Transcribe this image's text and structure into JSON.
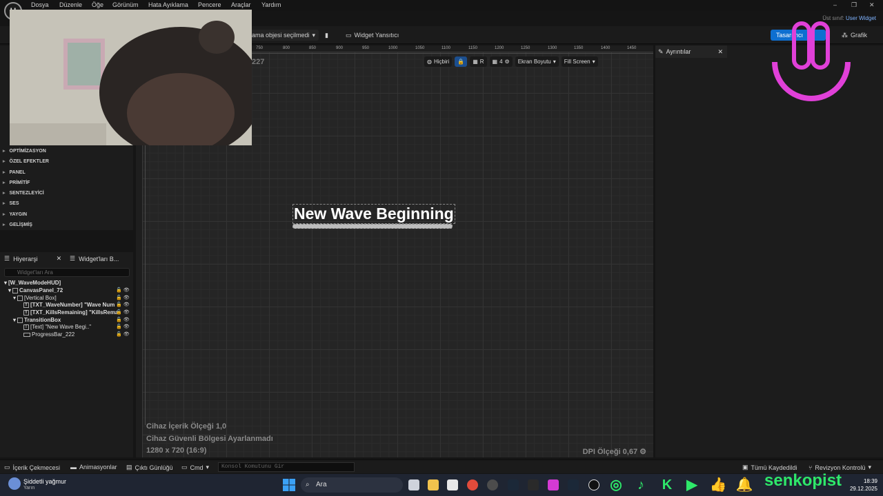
{
  "menu": [
    "Dosya",
    "Düzenle",
    "Öğe",
    "Görünüm",
    "Hata Ayıklama",
    "Pencere",
    "Araçlar",
    "Yardım"
  ],
  "parent_class": {
    "label": "Üst sınıf:",
    "value": "User Widget"
  },
  "toolbar": {
    "debug_filter": "ama objesi seçilmedi",
    "widget_reflector": "Widget Yansıtıcı",
    "designer": "Tasarımcı",
    "graph": "Grafik"
  },
  "palette": {
    "categories": [
      "OPTİMİZASYON",
      "ÖZEL EFEKTLER",
      "PANEL",
      "PRİMİTİF",
      "SENTEZLEYİCİ",
      "SES",
      "YAYGIN",
      "GELİŞMİŞ"
    ]
  },
  "hierarchy": {
    "tab": "Hiyerarşi",
    "tab2": "Widget'ları B...",
    "search_placeholder": "Widget'ları Ara",
    "nodes": [
      "[W_WaveModeHUD]",
      "CanvasPanel_72",
      "[Vertical Box]",
      "[TXT_WaveNumber] \"Wave Num",
      "[TXT_KillsRemaining] \"KillsRema",
      "TransitionBox",
      "[Text] \"New Wave Begi..\"",
      "ProgressBar_222"
    ]
  },
  "viewport": {
    "zoom": "227",
    "ruler": [
      "750",
      "800",
      "850",
      "900",
      "950",
      "1000",
      "1050",
      "1100",
      "1150",
      "1200",
      "1250",
      "1300",
      "1350",
      "1400",
      "1450"
    ],
    "none_label": "Hiçbiri",
    "r_label": "R",
    "grid_count": "4",
    "screen_size": "Ekran Boyutu",
    "fill_screen": "Fill Screen",
    "wave_text": "New Wave Beginning",
    "progress": 0.0,
    "info1": "Cihaz İçerik Ölçeği 1,0",
    "info2": "Cihaz Güvenli Bölgesi Ayarlanmadı",
    "info3": "1280 x 720 (16:9)",
    "dpi": "DPI Ölçeği 0,67"
  },
  "details": {
    "tab": "Ayrıntılar"
  },
  "bottom": {
    "content_drawer": "İçerik Çekmecesi",
    "animations": "Animasyonlar",
    "output_log": "Çıktı Günlüğü",
    "cmd": "Cmd",
    "console_placeholder": "Konsol Komutunu Gir",
    "save_all": "Tümü Kaydedildi",
    "revision": "Revizyon Kontrolü"
  },
  "taskbar": {
    "weather_title": "Şiddetli yağmur",
    "weather_sub": "Yarın",
    "search": "Ara",
    "brand": "senkopist",
    "time": "18:39",
    "date": "29.12.2025"
  },
  "colors": {
    "accent": "#0e6fd0",
    "brand": "#2ee86a",
    "magenta": "#e040d8"
  }
}
